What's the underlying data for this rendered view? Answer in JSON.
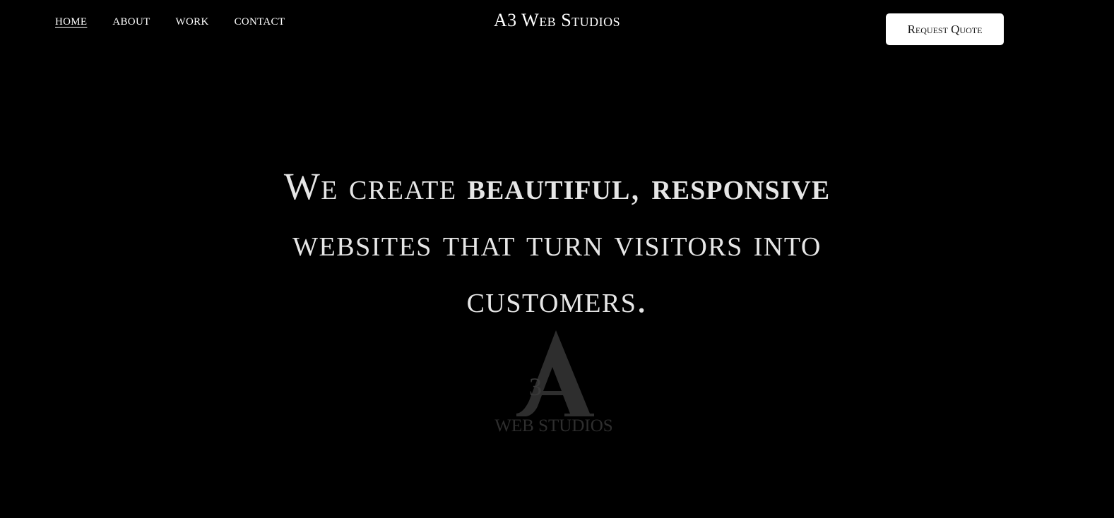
{
  "nav": {
    "items": [
      {
        "label": "HOME",
        "active": true
      },
      {
        "label": "ABOUT",
        "active": false
      },
      {
        "label": "WORK",
        "active": false
      },
      {
        "label": "CONTACT",
        "active": false
      }
    ]
  },
  "brand": {
    "title": "A3 Web Studios"
  },
  "header": {
    "cta_label": "Request Quote"
  },
  "hero": {
    "line1_pre": "We create ",
    "line1_bold1": "beautiful",
    "line1_comma": ", ",
    "line1_bold2": "responsive",
    "line2": "websites that turn visitors into",
    "line3": "customers."
  },
  "logo": {
    "number": "3",
    "text": "WEB STUDIOS",
    "color": "#2e2e2e"
  },
  "colors": {
    "background": "#000000",
    "text": "#ffffff",
    "hero_text": "#e6e6e6",
    "button_bg": "#ffffff"
  }
}
